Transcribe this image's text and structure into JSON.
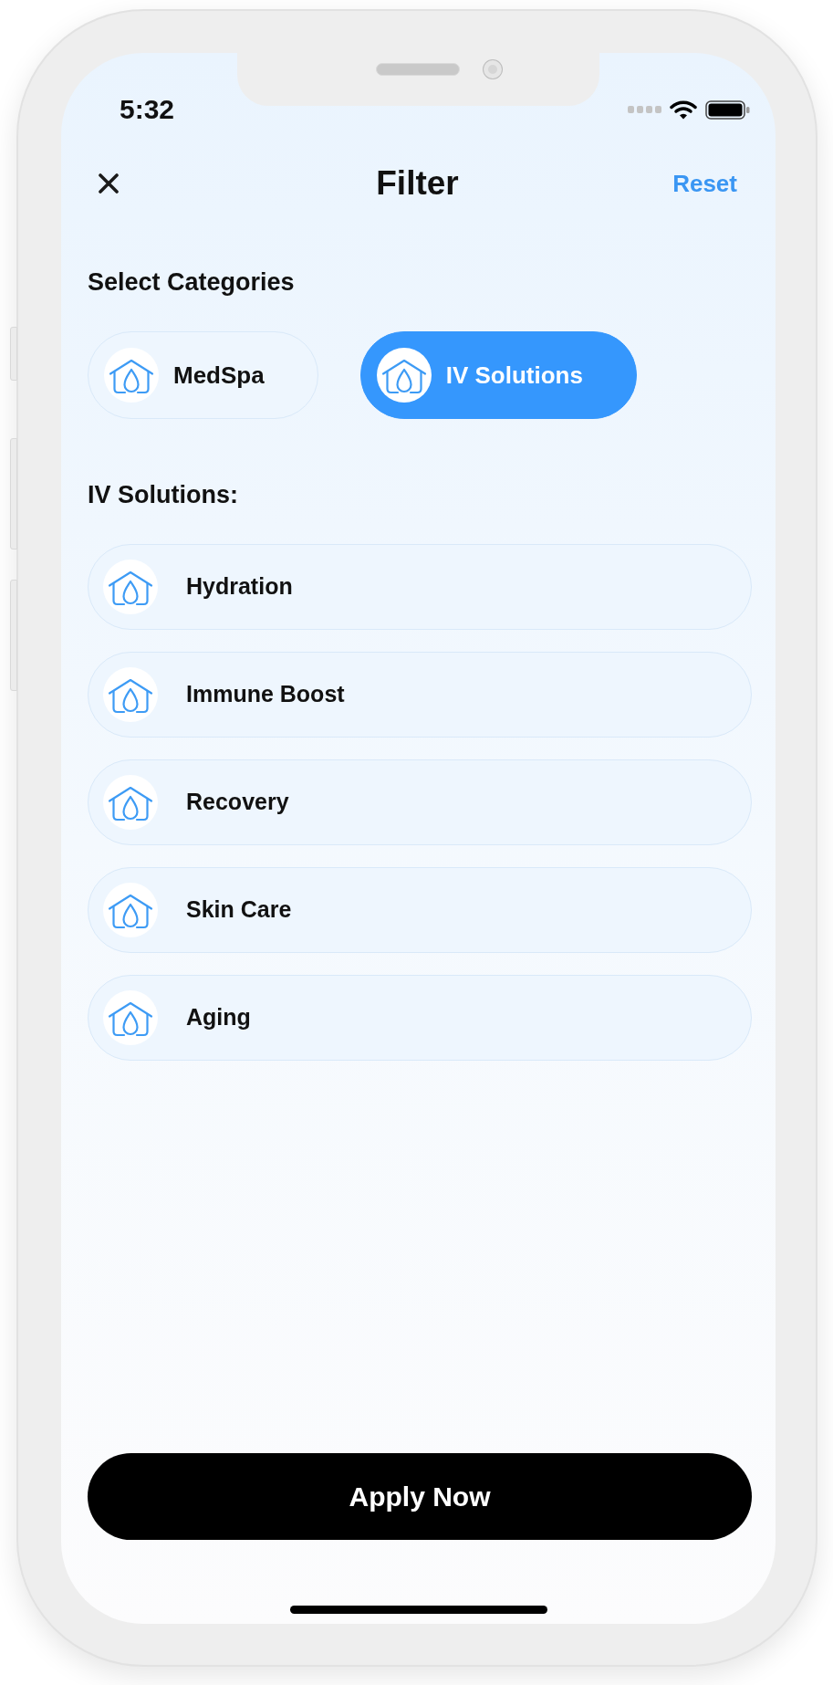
{
  "status_bar": {
    "time": "5:32"
  },
  "header": {
    "title": "Filter",
    "reset": "Reset"
  },
  "categories": {
    "heading": "Select Categories",
    "items": [
      {
        "label": "MedSpa",
        "selected": false
      },
      {
        "label": "IV Solutions",
        "selected": true
      }
    ]
  },
  "subcategories": {
    "heading": "IV Solutions:",
    "items": [
      {
        "label": "Hydration"
      },
      {
        "label": "Immune Boost"
      },
      {
        "label": "Recovery"
      },
      {
        "label": "Skin Care"
      },
      {
        "label": "Aging"
      }
    ]
  },
  "apply_button": {
    "label": "Apply Now"
  }
}
